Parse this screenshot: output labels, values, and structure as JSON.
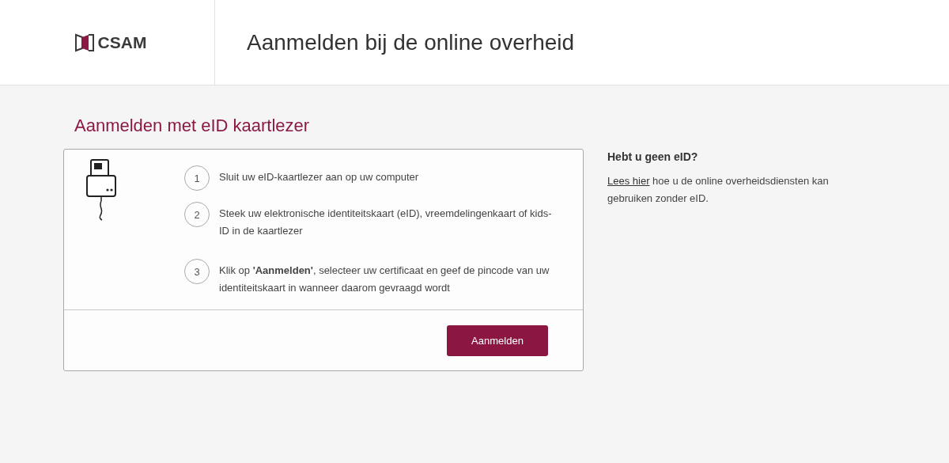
{
  "header": {
    "logo_text": "CSAM",
    "title": "Aanmelden bij de online overheid"
  },
  "heading": "Aanmelden met eID kaartlezer",
  "steps": [
    {
      "number": "1",
      "text": "Sluit uw eID-kaartlezer aan op uw computer"
    },
    {
      "number": "2",
      "text": "Steek uw elektronische identiteitskaart (eID), vreemdelingenkaart of kids-ID in de kaartlezer"
    },
    {
      "number": "3",
      "text": "Klik op **'Aanmelden'**, selecteer uw certificaat en geef de pincode van uw identiteitskaart in wanneer daarom gevraagd wordt"
    }
  ],
  "button": "Aanmelden",
  "aside": {
    "title": "Hebt u geen eID?",
    "link": "Lees hier",
    "text": " hoe u de online overheidsdiensten kan gebruiken zonder eID."
  }
}
